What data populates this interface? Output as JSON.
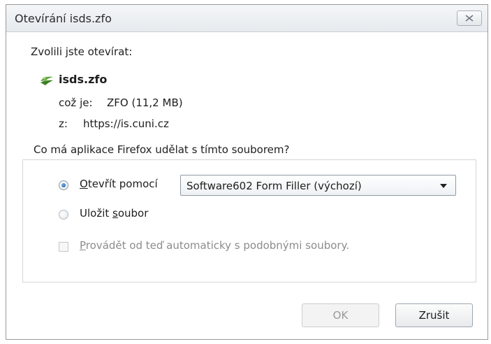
{
  "window": {
    "title": "Otevírání isds.zfo"
  },
  "dialog": {
    "intro": "Zvolili jste otevírat:",
    "file_name": "isds.zfo",
    "type_label": "což je:",
    "type_value": "ZFO (11,2 MB)",
    "from_label": "z:",
    "from_value": "https://is.cuni.cz",
    "question": "Co má aplikace Firefox udělat s tímto souborem?",
    "open_with": {
      "label_first": "O",
      "label_rest": "tevřít pomocí",
      "selected": true,
      "select_value": "Software602 Form Filler (výchozí)"
    },
    "save_file": {
      "label_before": "Uložit ",
      "label_u": "s",
      "label_after": "oubor",
      "selected": false
    },
    "auto": {
      "label_first": "P",
      "label_rest": "rovádět od teď automaticky s podobnými soubory.",
      "checked": false,
      "enabled": false
    }
  },
  "buttons": {
    "ok": "OK",
    "cancel": "Zrušit"
  },
  "icons": {
    "close": "close-icon",
    "file": "file-type-icon"
  }
}
